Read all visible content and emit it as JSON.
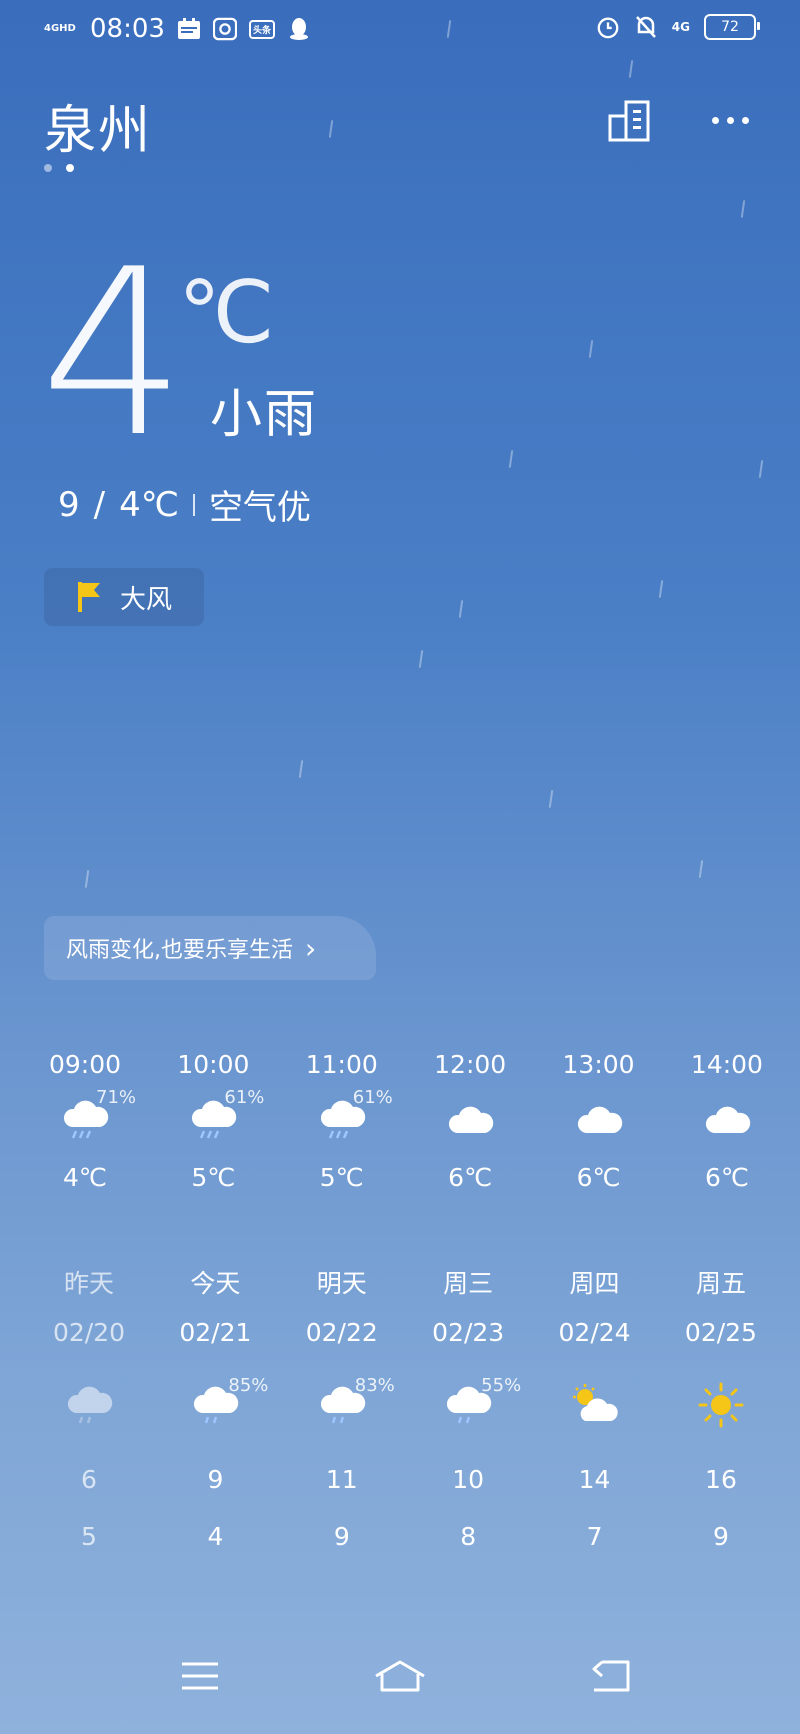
{
  "status_bar": {
    "signal": "4GHD",
    "time": "08:03",
    "notif_toutiao": "头条",
    "net": "4G",
    "battery": "72"
  },
  "header": {
    "city": "泉州"
  },
  "current": {
    "temp": "4",
    "unit": "℃",
    "condition": "小雨",
    "high": "9",
    "sep": "/",
    "low": "4℃",
    "air": "空气优"
  },
  "alert": {
    "label": "大风"
  },
  "slogan": {
    "text": "风雨变化,也要乐享生活",
    "chevron": "›"
  },
  "hourly": [
    {
      "time": "09:00",
      "pop": "71%",
      "temp": "4℃",
      "icon": "rain-cloud-icon"
    },
    {
      "time": "10:00",
      "pop": "61%",
      "temp": "5℃",
      "icon": "rain-cloud-icon"
    },
    {
      "time": "11:00",
      "pop": "61%",
      "temp": "5℃",
      "icon": "rain-cloud-icon"
    },
    {
      "time": "12:00",
      "pop": "",
      "temp": "6℃",
      "icon": "cloud-icon"
    },
    {
      "time": "13:00",
      "pop": "",
      "temp": "6℃",
      "icon": "cloud-icon"
    },
    {
      "time": "14:00",
      "pop": "",
      "temp": "6℃",
      "icon": "cloud-icon"
    }
  ],
  "daily": [
    {
      "name": "昨天",
      "date": "02/20",
      "pop": "",
      "high": "6",
      "low": "5",
      "icon": "rain-cloud-icon"
    },
    {
      "name": "今天",
      "date": "02/21",
      "pop": "85%",
      "high": "9",
      "low": "4",
      "icon": "rain-cloud-icon"
    },
    {
      "name": "明天",
      "date": "02/22",
      "pop": "83%",
      "high": "11",
      "low": "9",
      "icon": "rain-cloud-icon"
    },
    {
      "name": "周三",
      "date": "02/23",
      "pop": "55%",
      "high": "10",
      "low": "8",
      "icon": "rain-cloud-icon"
    },
    {
      "name": "周四",
      "date": "02/24",
      "pop": "",
      "high": "14",
      "low": "7",
      "icon": "partly-sunny-icon"
    },
    {
      "name": "周五",
      "date": "02/25",
      "pop": "",
      "high": "16",
      "low": "9",
      "icon": "sun-icon"
    }
  ],
  "colors": {
    "sun": "#f5c518",
    "flag": "#f5c518"
  }
}
